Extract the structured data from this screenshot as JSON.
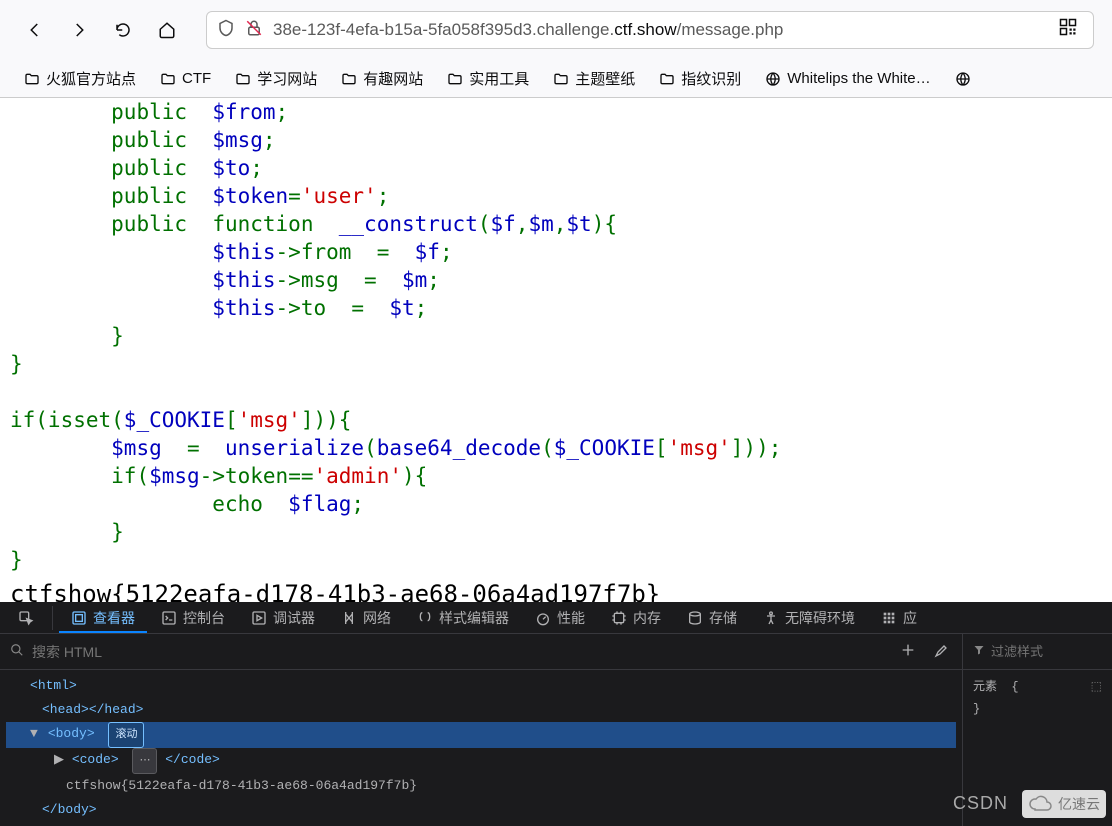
{
  "browser": {
    "url_visible": "38e-123f-4efa-b15a-5fa058f395d3.challenge.",
    "url_bold": "ctf.show",
    "url_path": "/message.php"
  },
  "bookmarks": [
    {
      "label": "火狐官方站点",
      "type": "folder"
    },
    {
      "label": "CTF",
      "type": "folder"
    },
    {
      "label": "学习网站",
      "type": "folder"
    },
    {
      "label": "有趣网站",
      "type": "folder"
    },
    {
      "label": "实用工具",
      "type": "folder"
    },
    {
      "label": "主题壁纸",
      "type": "folder"
    },
    {
      "label": "指纹识别",
      "type": "folder"
    },
    {
      "label": "Whitelips the White…",
      "type": "site"
    }
  ],
  "code": {
    "l0": "        public  $from;",
    "l1": "        public  $msg;",
    "l2": "        public  $to;",
    "l3": "        public  $token='user';",
    "l4": "        public  function  __construct($f,$m,$t){",
    "l5": "                $this->from  =  $f;",
    "l6": "                $this->msg  =  $m;",
    "l7": "                $this->to  =  $t;",
    "l8": "        }",
    "l9": "}",
    "l10": "",
    "l11": "if(isset($_COOKIE['msg'])){",
    "l12": "        $msg  =  unserialize(base64_decode($_COOKIE['msg']));",
    "l13": "        if($msg->token=='admin'){",
    "l14": "                echo  $flag;",
    "l15": "        }",
    "l16": "}"
  },
  "flag": "ctfshow{5122eafa-d178-41b3-ae68-06a4ad197f7b}",
  "devtools": {
    "tabs": {
      "inspector": "查看器",
      "console": "控制台",
      "debugger": "调试器",
      "network": "网络",
      "style_editor": "样式编辑器",
      "performance": "性能",
      "memory": "内存",
      "storage": "存储",
      "accessibility": "无障碍环境",
      "app": "应"
    },
    "search_placeholder": "搜索 HTML",
    "filter_placeholder": "过滤样式",
    "tree": {
      "html": "html",
      "head_open": "<head>",
      "head_close": "</head>",
      "body": "body",
      "scroll_badge": "滚动",
      "code_open": "<code>",
      "code_close": "</code>",
      "flag_text": "ctfshow{5122eafa-d178-41b3-ae68-06a4ad197f7b}",
      "body_close": "</body>"
    },
    "styles": {
      "element": "元素",
      "brace_open": "{",
      "brace_close": "}"
    }
  },
  "watermarks": {
    "csdn": "CSDN",
    "ysy": "亿速云"
  }
}
